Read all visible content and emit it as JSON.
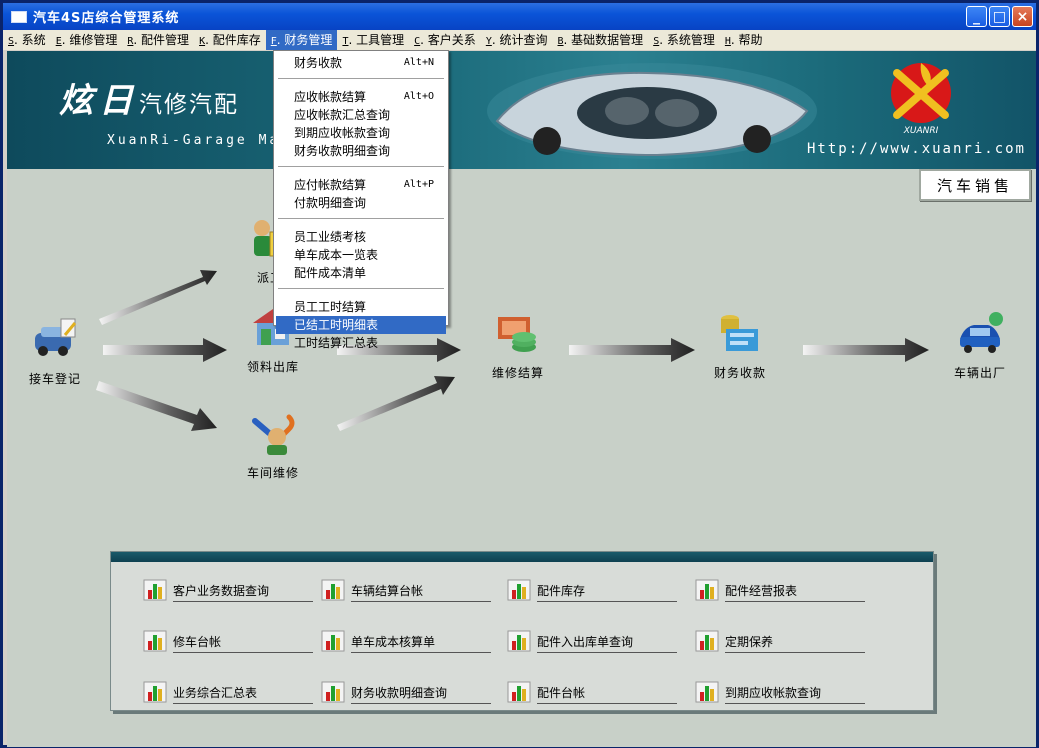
{
  "window": {
    "title": "汽车4S店综合管理系统",
    "buttons": {
      "min": "_",
      "max": "□",
      "close": "×"
    }
  },
  "menubar": [
    {
      "acc": "S",
      "label": "系统"
    },
    {
      "acc": "E",
      "label": "维修管理"
    },
    {
      "acc": "R",
      "label": "配件管理"
    },
    {
      "acc": "K",
      "label": "配件库存"
    },
    {
      "acc": "F",
      "label": "财务管理",
      "active": true
    },
    {
      "acc": "T",
      "label": "工具管理"
    },
    {
      "acc": "C",
      "label": "客户关系"
    },
    {
      "acc": "Y",
      "label": "统计查询"
    },
    {
      "acc": "B",
      "label": "基础数据管理"
    },
    {
      "acc": "S",
      "label": "系统管理"
    },
    {
      "acc": "H",
      "label": "帮助"
    }
  ],
  "banner": {
    "brand_main": "炫日",
    "brand_sub": "汽修汽配",
    "english": "XuanRi-Garage Mana",
    "url": "Http://www.xuanri.com",
    "logo_text": "XUANRI"
  },
  "sale_button": "汽车销售",
  "flow": {
    "reception": "接车登记",
    "dispatch": "派工",
    "parts_out": "领料出库",
    "workshop": "车间维修",
    "settlement": "维修结算",
    "payment": "财务收款",
    "exit": "车辆出厂"
  },
  "quick_links": [
    "客户业务数据查询",
    "车辆结算台帐",
    "配件库存",
    "配件经营报表",
    "修车台帐",
    "单车成本核算单",
    "配件入出库单查询",
    "定期保养",
    "业务综合汇总表",
    "财务收款明细查询",
    "配件台帐",
    "到期应收帐款查询"
  ],
  "dropdown": {
    "groups": [
      [
        {
          "label": "财务收款",
          "shortcut": "Alt+N"
        }
      ],
      [
        {
          "label": "应收帐款结算",
          "shortcut": "Alt+O"
        },
        {
          "label": "应收帐款汇总查询",
          "shortcut": ""
        },
        {
          "label": "到期应收帐款查询",
          "shortcut": ""
        },
        {
          "label": "财务收款明细查询",
          "shortcut": ""
        }
      ],
      [
        {
          "label": "应付帐款结算",
          "shortcut": "Alt+P"
        },
        {
          "label": "付款明细查询",
          "shortcut": ""
        }
      ],
      [
        {
          "label": "员工业绩考核",
          "shortcut": ""
        },
        {
          "label": "单车成本一览表",
          "shortcut": ""
        },
        {
          "label": "配件成本清单",
          "shortcut": ""
        }
      ],
      [
        {
          "label": "员工工时结算",
          "shortcut": ""
        },
        {
          "label": "已结工时明细表",
          "shortcut": "",
          "highlighted": true
        },
        {
          "label": "工时结算汇总表",
          "shortcut": ""
        }
      ]
    ]
  },
  "colors": {
    "title_bar": "#0a54d8",
    "menu_highlight": "#316ac5",
    "workspace": "#c8d0c8",
    "banner": "#1b6a7a"
  }
}
